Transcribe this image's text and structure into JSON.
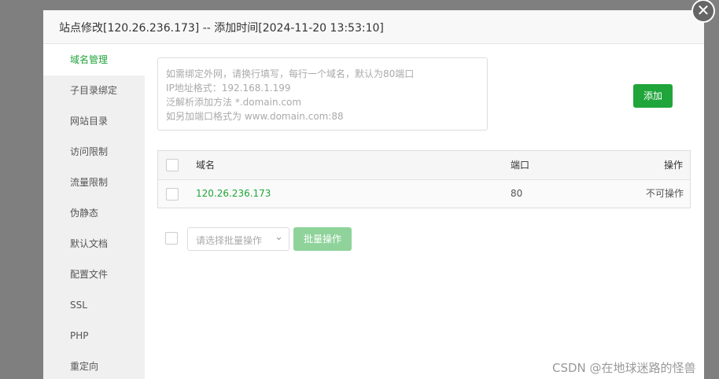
{
  "dialog": {
    "title": "站点修改[120.26.236.173] -- 添加时间[2024-11-20 13:53:10]",
    "close_glyph": "✕"
  },
  "sidebar": {
    "items": [
      {
        "label": "域名管理",
        "active": true
      },
      {
        "label": "子目录绑定"
      },
      {
        "label": "网站目录"
      },
      {
        "label": "访问限制"
      },
      {
        "label": "流量限制"
      },
      {
        "label": "伪静态"
      },
      {
        "label": "默认文档"
      },
      {
        "label": "配置文件"
      },
      {
        "label": "SSL"
      },
      {
        "label": "PHP"
      },
      {
        "label": "重定向"
      }
    ]
  },
  "domain_input": {
    "placeholder_lines": [
      "如需绑定外网，请换行填写，每行一个域名，默认为80端口",
      "IP地址格式：192.168.1.199",
      "泛解析添加方法 *.domain.com",
      "如另加端口格式为 www.domain.com:88"
    ]
  },
  "add_button": {
    "label": "添加"
  },
  "table": {
    "headers": {
      "domain": "域名",
      "port": "端口",
      "action": "操作"
    },
    "rows": [
      {
        "domain": "120.26.236.173",
        "port": "80",
        "action": "不可操作"
      }
    ]
  },
  "batch": {
    "select_placeholder": "请选择批量操作",
    "button_label": "批量操作"
  },
  "watermark": "CSDN @在地球迷路的怪兽",
  "colors": {
    "accent": "#20a53a",
    "link": "#20a53a",
    "sidebar_bg": "#f0f0f0",
    "overlay": "#7f7f7f"
  }
}
